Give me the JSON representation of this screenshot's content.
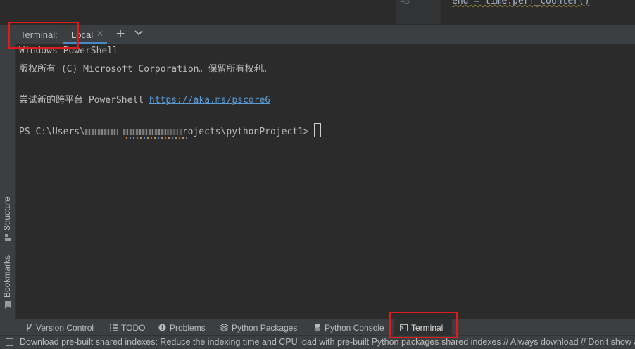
{
  "editor": {
    "line_number": "43",
    "code": "end = time.perf_counter()"
  },
  "terminal_header": {
    "title": "Terminal:",
    "tab_label": "Local"
  },
  "left_strip": {
    "structure_label": "Structure",
    "bookmarks_label": "Bookmarks"
  },
  "terminal": {
    "line1": "Windows PowerShell",
    "line2": "版权所有 (C) Microsoft Corporation。保留所有权利。",
    "line3_prefix": "尝试新的跨平台 PowerShell ",
    "line3_link": "https://aka.ms/pscore6",
    "prompt_start": "PS C:\\Users\\",
    "prompt_end": "rojects\\pythonProject1>"
  },
  "tool_windows": [
    {
      "label": "Version Control",
      "icon": "branch-icon"
    },
    {
      "label": "TODO",
      "icon": "list-icon"
    },
    {
      "label": "Problems",
      "icon": "warning-icon"
    },
    {
      "label": "Python Packages",
      "icon": "layers-icon"
    },
    {
      "label": "Python Console",
      "icon": "python-icon"
    },
    {
      "label": "Terminal",
      "icon": "terminal-icon",
      "active": true
    }
  ],
  "status_bar": {
    "message": "Download pre-built shared indexes: Reduce the indexing time and CPU load with pre-built Python packages shared indexes // Always download // Don't show again"
  },
  "colors": {
    "link": "#5a9bd5",
    "highlight": "#e01b1b",
    "tab_underline": "#4a88c7"
  }
}
